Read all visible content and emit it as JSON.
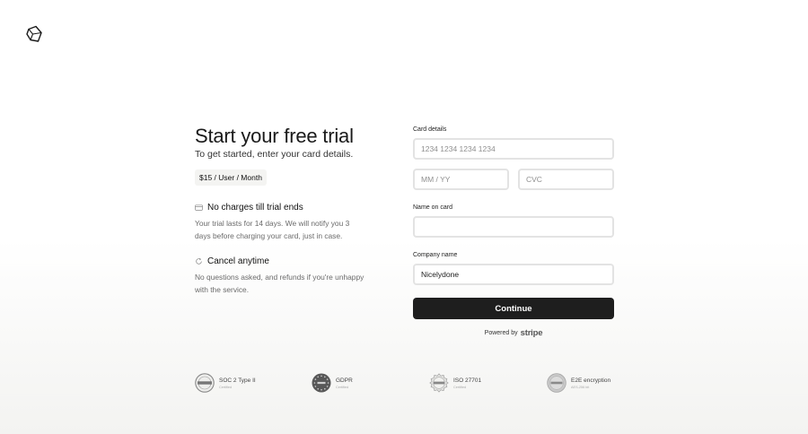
{
  "left": {
    "title": "Start your free trial",
    "subtitle": "To get started, enter your card details.",
    "price_badge": "$15 / User / Month",
    "features": [
      {
        "icon": "credit-card-icon",
        "title": "No charges till trial ends",
        "description": "Your trial lasts for 14 days. We will notify you 3 days before charging your card, just in case."
      },
      {
        "icon": "refresh-icon",
        "title": "Cancel anytime",
        "description": "No questions asked, and refunds if you're unhappy with the service."
      }
    ]
  },
  "form": {
    "card_label": "Card details",
    "card_number_placeholder": "1234 1234 1234 1234",
    "expiry_placeholder": "MM / YY",
    "cvc_placeholder": "CVC",
    "name_label": "Name on card",
    "name_value": "",
    "company_label": "Company name",
    "company_value": "Nicelydone",
    "continue_label": "Continue",
    "powered_by": "Powered by",
    "stripe": "stripe"
  },
  "badges": [
    {
      "icon": "soc2-seal-icon",
      "title": "SOC 2 Type II",
      "sub": "Certified"
    },
    {
      "icon": "gdpr-seal-icon",
      "title": "GDPR",
      "sub": "Certified"
    },
    {
      "icon": "iso-seal-icon",
      "title": "ISO 27701",
      "sub": "Certified"
    },
    {
      "icon": "aes-seal-icon",
      "title": "E2E encryption",
      "sub": "AES-256 bit"
    }
  ]
}
